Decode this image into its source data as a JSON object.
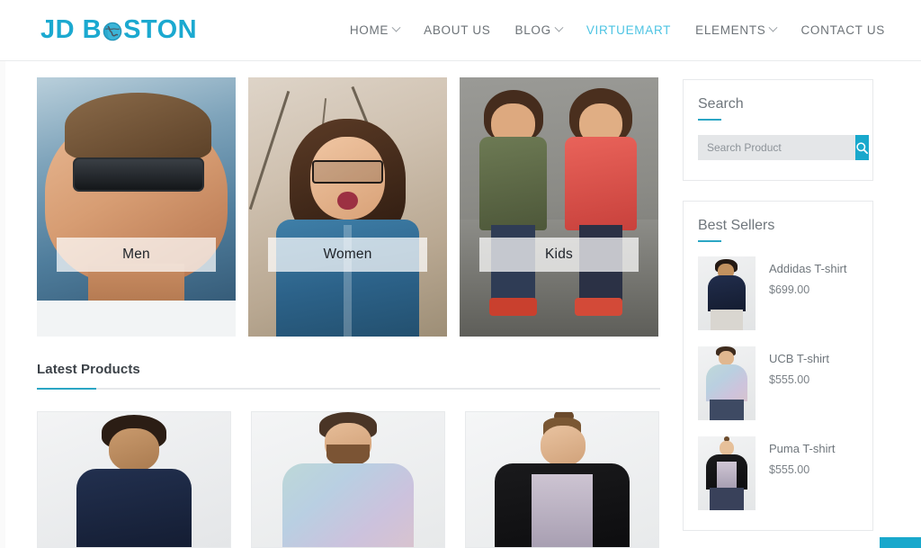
{
  "header": {
    "logo": {
      "prefix": "JD B",
      "suffix": "STON",
      "icon": "globe-icon",
      "color": "#1ba9d0"
    },
    "nav": [
      {
        "label": "HOME",
        "has_dropdown": true,
        "active": false
      },
      {
        "label": "ABOUT US",
        "has_dropdown": false,
        "active": false
      },
      {
        "label": "BLOG",
        "has_dropdown": true,
        "active": false
      },
      {
        "label": "VIRTUEMART",
        "has_dropdown": false,
        "active": true
      },
      {
        "label": "ELEMENTS",
        "has_dropdown": true,
        "active": false
      },
      {
        "label": "CONTACT US",
        "has_dropdown": false,
        "active": false
      }
    ]
  },
  "categories": [
    {
      "label": "Men"
    },
    {
      "label": "Women"
    },
    {
      "label": "Kids"
    }
  ],
  "latest_products": {
    "title": "Latest Products",
    "items": [
      {
        "name": "navy-tshirt-product"
      },
      {
        "name": "pastel-tshirt-product"
      },
      {
        "name": "black-panel-tshirt-product"
      }
    ]
  },
  "sidebar": {
    "search_widget": {
      "title": "Search",
      "placeholder": "Search Product",
      "value": "",
      "button_icon": "search-icon"
    },
    "best_sellers_widget": {
      "title": "Best Sellers",
      "items": [
        {
          "name": "Addidas T-shirt",
          "price": "$699.00"
        },
        {
          "name": "UCB T-shirt",
          "price": "$555.00"
        },
        {
          "name": "Puma T-shirt",
          "price": "$555.00"
        }
      ]
    }
  },
  "colors": {
    "accent": "#19a8cc",
    "accent_light": "#4ec4e3",
    "logo": "#1ba9d0",
    "text": "#6f767c",
    "border": "#e7e9eb"
  },
  "scroll_top_button": {
    "icon": "arrow-up-icon"
  }
}
